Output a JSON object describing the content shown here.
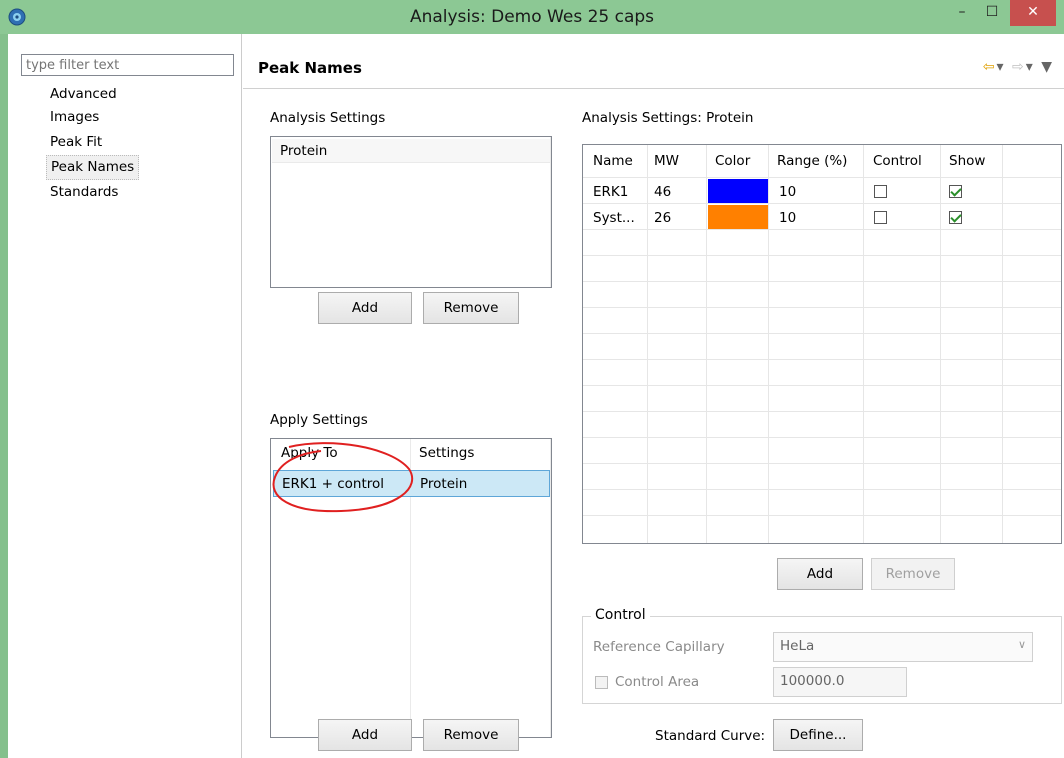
{
  "window": {
    "title": "Analysis: Demo Wes 25 caps",
    "controls": {
      "minimize": "–",
      "maximize": "☐",
      "close": "✕"
    }
  },
  "nav": {
    "filter_placeholder": "type filter text",
    "items": [
      "Advanced",
      "Images",
      "Peak Fit",
      "Peak Names",
      "Standards"
    ],
    "selected": "Peak Names"
  },
  "page": {
    "title": "Peak Names",
    "tools": {
      "back": "⇦",
      "back_menu": "▾",
      "forward": "⇨",
      "forward_menu": "▾",
      "view_menu": "▼"
    }
  },
  "analysis_settings": {
    "label": "Analysis Settings",
    "items": [
      "Protein"
    ],
    "add_label": "Add",
    "remove_label": "Remove"
  },
  "apply_settings": {
    "label": "Apply Settings",
    "columns": [
      "Apply To",
      "Settings"
    ],
    "rows": [
      {
        "apply_to": "ERK1 + control",
        "settings": "Protein"
      }
    ],
    "add_label": "Add",
    "remove_label": "Remove"
  },
  "protein_settings": {
    "label": "Analysis Settings: Protein",
    "columns": [
      "Name",
      "MW",
      "Color",
      "Range (%)",
      "Control",
      "Show"
    ],
    "rows": [
      {
        "name": "ERK1",
        "mw": "46",
        "color": "#0000ff",
        "range": "10",
        "control": false,
        "show": true
      },
      {
        "name": "Syst...",
        "mw": "26",
        "color": "#ff8000",
        "range": "10",
        "control": false,
        "show": true
      }
    ],
    "add_label": "Add",
    "remove_label": "Remove"
  },
  "control": {
    "legend": "Control",
    "reference_label": "Reference Capillary",
    "reference_value": "HeLa",
    "dropdown_icon": "chevron-down",
    "control_area_label": "Control Area",
    "control_area_value": "100000.0",
    "control_area_checked": false
  },
  "standard_curve": {
    "label": "Standard Curve:",
    "button_label": "Define..."
  },
  "colors": {
    "titlebar": "#8cc894",
    "selection": "#cce8f6",
    "close_button": "#c7504e",
    "annotation_circle": "#e02020"
  }
}
